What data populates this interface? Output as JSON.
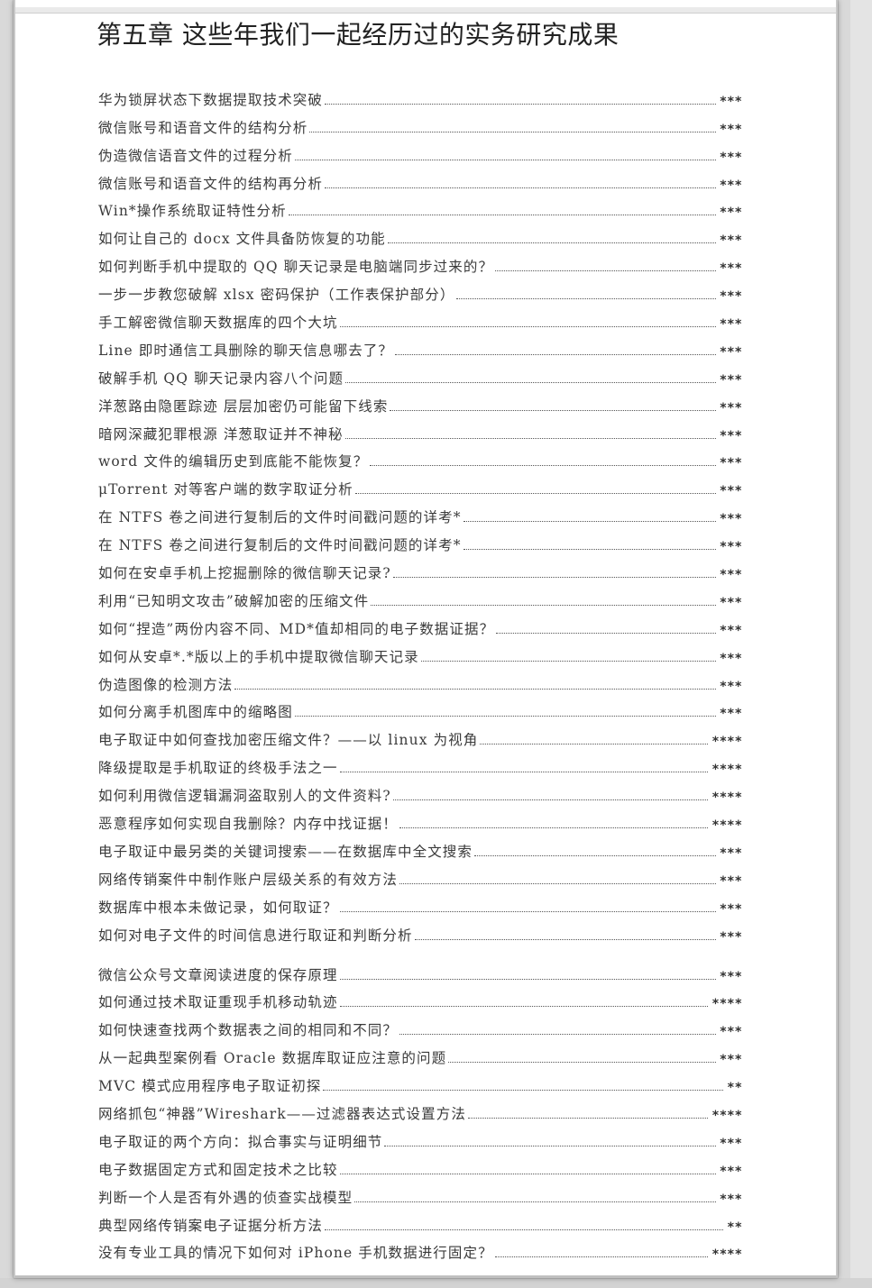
{
  "chapter_title": "第五章  这些年我们一起经历过的实务研究成果",
  "toc": [
    {
      "title": "华为锁屏状态下数据提取技术突破",
      "page": "***"
    },
    {
      "title": "微信账号和语音文件的结构分析",
      "page": "***"
    },
    {
      "title": "伪造微信语音文件的过程分析",
      "page": "***"
    },
    {
      "title": "微信账号和语音文件的结构再分析",
      "page": "***"
    },
    {
      "title": "Win*操作系统取证特性分析",
      "page": "***"
    },
    {
      "title": "如何让自己的 docx 文件具备防恢复的功能",
      "page": "***"
    },
    {
      "title": "如何判断手机中提取的 QQ 聊天记录是电脑端同步过来的？",
      "page": "***"
    },
    {
      "title": "一步一步教您破解 xlsx 密码保护（工作表保护部分）",
      "page": "***"
    },
    {
      "title": "手工解密微信聊天数据库的四个大坑",
      "page": "***"
    },
    {
      "title": "Line 即时通信工具删除的聊天信息哪去了？",
      "page": "***"
    },
    {
      "title": "破解手机 QQ 聊天记录内容八个问题",
      "page": "***"
    },
    {
      "title": "洋葱路由隐匿踪迹  层层加密仍可能留下线索",
      "page": "***"
    },
    {
      "title": "暗网深藏犯罪根源 洋葱取证并不神秘",
      "page": "***"
    },
    {
      "title": "word 文件的编辑历史到底能不能恢复？",
      "page": "***"
    },
    {
      "title": "μTorrent 对等客户端的数字取证分析",
      "page": "***"
    },
    {
      "title": "在 NTFS 卷之间进行复制后的文件时间戳问题的详考*",
      "page": "***"
    },
    {
      "title": "在 NTFS 卷之间进行复制后的文件时间戳问题的详考*",
      "page": "***"
    },
    {
      "title": "如何在安卓手机上挖掘删除的微信聊天记录?",
      "page": "***"
    },
    {
      "title": "利用“已知明文攻击”破解加密的压缩文件",
      "page": "***"
    },
    {
      "title": "如何“捏造”两份内容不同、MD*值却相同的电子数据证据？",
      "page": "***"
    },
    {
      "title": "如何从安卓*.*版以上的手机中提取微信聊天记录",
      "page": "***"
    },
    {
      "title": "伪造图像的检测方法",
      "page": "***"
    },
    {
      "title": "如何分离手机图库中的缩略图",
      "page": "***"
    },
    {
      "title": "电子取证中如何查找加密压缩文件？——以 linux 为视角",
      "page": "****"
    },
    {
      "title": "降级提取是手机取证的终极手法之一",
      "page": "****"
    },
    {
      "title": "如何利用微信逻辑漏洞盗取别人的文件资料?",
      "page": "****"
    },
    {
      "title": "恶意程序如何实现自我删除？内存中找证据！",
      "page": "****"
    },
    {
      "title": "电子取证中最另类的关键词搜索——在数据库中全文搜索",
      "page": "***"
    },
    {
      "title": "网络传销案件中制作账户层级关系的有效方法",
      "page": "***"
    },
    {
      "title": "数据库中根本未做记录，如何取证？",
      "page": "***"
    },
    {
      "title": "如何对电子文件的时间信息进行取证和判断分析",
      "page": "***"
    },
    {
      "title": "微信公众号文章阅读进度的保存原理",
      "page": "***",
      "gap_before": true
    },
    {
      "title": "如何通过技术取证重现手机移动轨迹",
      "page": "****"
    },
    {
      "title": "如何快速查找两个数据表之间的相同和不同？",
      "page": "***"
    },
    {
      "title": "从一起典型案例看 Oracle 数据库取证应注意的问题",
      "page": "***"
    },
    {
      "title": "MVC 模式应用程序电子取证初探",
      "page": "**"
    },
    {
      "title": "网络抓包“神器”Wireshark——过滤器表达式设置方法",
      "page": "****"
    },
    {
      "title": "电子取证的两个方向：拟合事实与证明细节",
      "page": "***"
    },
    {
      "title": "电子数据固定方式和固定技术之比较",
      "page": "***"
    },
    {
      "title": "判断一个人是否有外遇的侦查实战模型",
      "page": "***"
    },
    {
      "title": "典型网络传销案电子证据分析方法",
      "page": "**"
    },
    {
      "title": "没有专业工具的情况下如何对 iPhone 手机数据进行固定？",
      "page": "****"
    }
  ]
}
